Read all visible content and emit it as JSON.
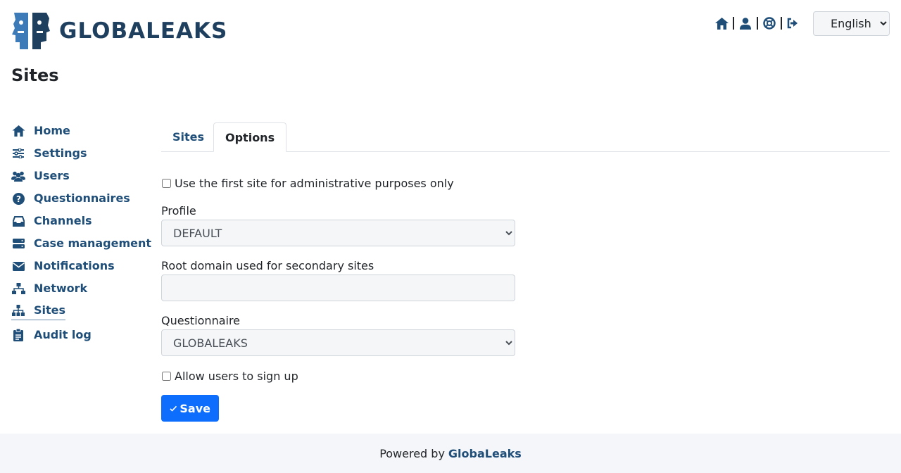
{
  "header": {
    "brand_name": "GLOBALEAKS",
    "language": {
      "selected": "English",
      "options": [
        "English"
      ]
    },
    "icons": [
      "home-icon",
      "user-icon",
      "support-icon",
      "logout-icon"
    ]
  },
  "page": {
    "title": "Sites"
  },
  "sidebar": {
    "items": [
      {
        "label": "Home",
        "icon": "home-icon"
      },
      {
        "label": "Settings",
        "icon": "sliders-icon"
      },
      {
        "label": "Users",
        "icon": "users-icon"
      },
      {
        "label": "Questionnaires",
        "icon": "question-icon"
      },
      {
        "label": "Channels",
        "icon": "inbox-icon"
      },
      {
        "label": "Case management",
        "icon": "server-icon"
      },
      {
        "label": "Notifications",
        "icon": "envelope-icon"
      },
      {
        "label": "Network",
        "icon": "network-icon"
      },
      {
        "label": "Sites",
        "icon": "sitemap-icon",
        "active": true
      },
      {
        "label": "Audit log",
        "icon": "clipboard-icon"
      }
    ]
  },
  "tabs": [
    {
      "label": "Sites",
      "active": false
    },
    {
      "label": "Options",
      "active": true
    }
  ],
  "form": {
    "admin_only_label": "Use the first site for administrative purposes only",
    "admin_only_checked": false,
    "profile_label": "Profile",
    "profile_value": "DEFAULT",
    "root_domain_label": "Root domain used for secondary sites",
    "root_domain_value": "",
    "questionnaire_label": "Questionnaire",
    "questionnaire_value": "GLOBALEAKS",
    "signup_label": "Allow users to sign up",
    "signup_checked": false,
    "save_label": "Save"
  },
  "footer": {
    "prefix": "Powered by",
    "brand": "GlobaLeaks"
  },
  "colors": {
    "brand_dark": "#1f3f5f",
    "link": "#1f4e79",
    "primary_button": "#0d6efd",
    "footer_bg": "#f5f6f9"
  }
}
